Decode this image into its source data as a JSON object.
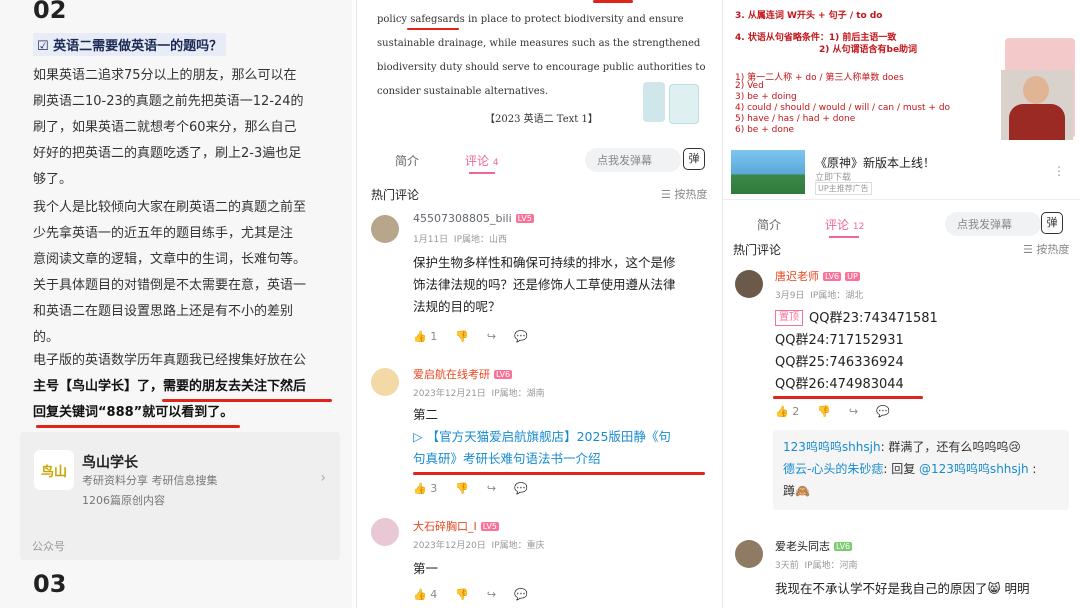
{
  "panel1": {
    "section_top": "02",
    "question": "☑ 英语二需要做英语一的题吗？",
    "paragraphs": [
      [
        "如果英语二追求75分以上的朋友，那么可以在",
        "刷英语二10-23的真题之前先把英语一12-24的",
        "刷了，如果英语二就想考个60来分，那么自己",
        "好好的把英语二的真题吃透了，刷上2-3遍也足",
        "够了。"
      ],
      [
        "我个人是比较倾向大家在刷英语二的真题之前至",
        "少先拿英语一的近五年的题目练手，尤其是注",
        "意阅读文章的逻辑，文章中的生词，长难句等。",
        "关于具体题目的对错倒是不太需要在意，英语一",
        "和英语二在题目设置思路上还是有不小的差别",
        "的。"
      ]
    ],
    "highlight": [
      "电子版的英语数学历年真题我已经搜集好放在公",
      "主号【鸟山学长】了，需要的朋友去关注下然后",
      "回复关键词“888”就可以看到了。"
    ],
    "card": {
      "logo": "鸟山",
      "name": "鸟山学长",
      "desc": "考研资料分享 考研信息搜集",
      "count": "1206篇原创内容",
      "foot": "公众号"
    },
    "section_bottom": "03"
  },
  "panel2": {
    "paper_lines": [
      "policy safegsards in place to protect biodiversity and ensure",
      "sustainable drainage, while measures such as the strengthened",
      "biodiversity duty should serve to encourage public authorities to",
      "consider sustainable alternatives."
    ],
    "citation": "【2023 英语二 Text 1】",
    "tabs": {
      "intro": "简介",
      "comments": "评论",
      "comment_count": "4",
      "danmu": "点我发弹幕",
      "danmu_icon": "弹"
    },
    "hot_label": "热门评论",
    "sort_label": "按热度",
    "comments": [
      {
        "user": "45507308805_bili",
        "level": "LV5",
        "date": "1月11日",
        "ip": "IP属地：山西",
        "lines": [
          "保护生物多样性和确保可持续的排水，这个是修",
          "饰法律法规的吗？还是修饰人工草使用遵从法律",
          "法规的目的呢？"
        ],
        "likes": "1"
      },
      {
        "user": "爱启航在线考研",
        "level": "LV6",
        "date": "2023年12月21日",
        "ip": "IP属地：湖南",
        "lines": [
          "第二"
        ],
        "link": [
          "【官方天猫爱启航旗舰店】2025版田静《句",
          "句真研》考研长难句语法书一介绍"
        ],
        "likes": "3"
      },
      {
        "user": "大石碎胸口_I",
        "level": "LV5",
        "date": "2023年12月20日",
        "ip": "IP属地：重庆",
        "lines": [
          "第一"
        ],
        "likes": "4"
      }
    ]
  },
  "panel3": {
    "board_lines": [
      "3. 从属连词 W开头 + 句子 / to do",
      "4. 状语从句省略条件：1) 前后主语一致",
      "2) 从句谓语含有be助词",
      "1) 第一二人称 + do / 第三人称单数 does",
      "2) Ved",
      "3) be + doing",
      "4) could / should / would / will / can / must + do",
      "5) have / has / had + done",
      "6) be + done"
    ],
    "ad": {
      "title": "《原神》新版本上线！",
      "sub": "立即下载",
      "badge": "UP主推荐广告",
      "more": "⋮"
    },
    "tabs": {
      "intro": "简介",
      "comments": "评论",
      "comment_count": "12",
      "danmu": "点我发弹幕",
      "danmu_icon": "弹"
    },
    "hot_label": "热门评论",
    "sort_label": "按热度",
    "main_comment": {
      "user": "唐迟老师",
      "level": "LV6",
      "up": "UP",
      "date": "3月9日",
      "ip": "IP属地：湖北",
      "top_tag": "置顶",
      "lines": [
        "QQ群23:743471581",
        "QQ群24:717152931",
        "QQ群25:746336924",
        "QQ群26:474983044"
      ],
      "likes": "2"
    },
    "replies": [
      {
        "user": "123呜呜呜shhsjh",
        "text": ": 群满了，还有么呜呜呜😢"
      },
      {
        "user": "德云-心头的朱砂痣",
        "text": ": 回复 ",
        "mention": "@123呜呜呜shhsjh",
        "tail": " :"
      },
      {
        "user": "",
        "text": "蹲🙈"
      }
    ],
    "second_comment": {
      "user": "爱老头同志",
      "level": "LV6",
      "date": "3天前",
      "ip": "IP属地：河南",
      "line": "我现在不承认学不好是我自己的原因了😸 明明"
    }
  },
  "colors": {
    "accent": "#f06795",
    "annotation_red": "#e0231b",
    "link_blue": "#178bcf"
  }
}
